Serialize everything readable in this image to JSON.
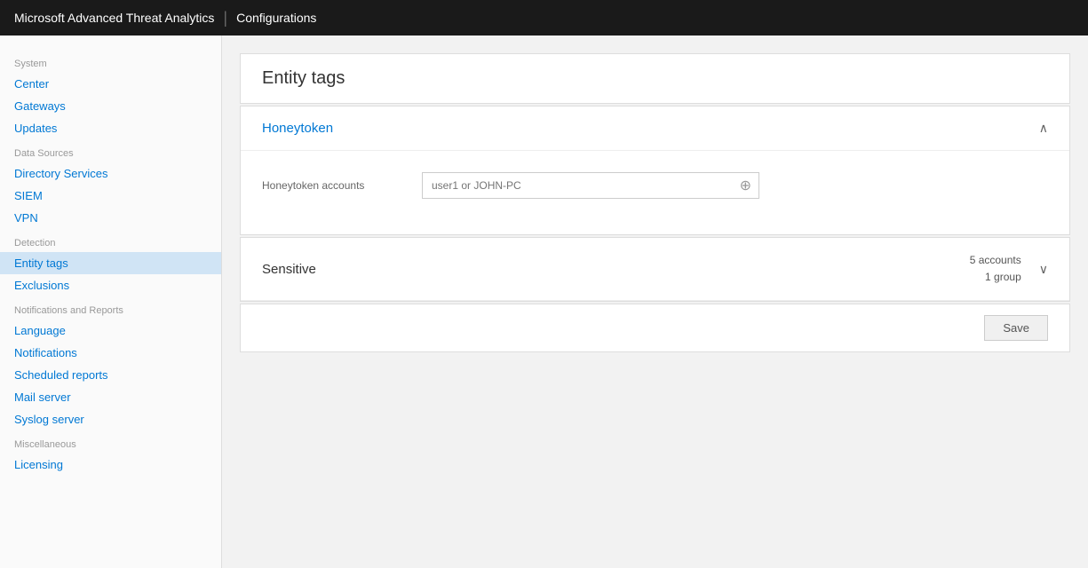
{
  "header": {
    "app_name": "Microsoft Advanced Threat Analytics",
    "divider": "|",
    "section": "Configurations"
  },
  "sidebar": {
    "system_label": "System",
    "items_system": [
      {
        "id": "center",
        "label": "Center"
      },
      {
        "id": "gateways",
        "label": "Gateways"
      },
      {
        "id": "updates",
        "label": "Updates"
      }
    ],
    "data_sources_label": "Data Sources",
    "items_data_sources": [
      {
        "id": "directory-services",
        "label": "Directory Services"
      },
      {
        "id": "siem",
        "label": "SIEM"
      },
      {
        "id": "vpn",
        "label": "VPN"
      }
    ],
    "detection_label": "Detection",
    "items_detection": [
      {
        "id": "entity-tags",
        "label": "Entity tags",
        "active": true
      },
      {
        "id": "exclusions",
        "label": "Exclusions"
      }
    ],
    "notifications_reports_label": "Notifications and Reports",
    "items_notifications": [
      {
        "id": "language",
        "label": "Language"
      },
      {
        "id": "notifications",
        "label": "Notifications"
      },
      {
        "id": "scheduled-reports",
        "label": "Scheduled reports"
      },
      {
        "id": "mail-server",
        "label": "Mail server"
      },
      {
        "id": "syslog-server",
        "label": "Syslog server"
      }
    ],
    "miscellaneous_label": "Miscellaneous",
    "items_misc": [
      {
        "id": "licensing",
        "label": "Licensing"
      }
    ]
  },
  "main": {
    "page_title": "Entity tags",
    "honeytoken": {
      "title": "Honeytoken",
      "accounts_label": "Honeytoken accounts",
      "accounts_placeholder": "user1 or JOHN-PC",
      "add_icon": "⊕"
    },
    "sensitive": {
      "title": "Sensitive",
      "accounts_count": "5 accounts",
      "group_count": "1 group",
      "chevron": "∨"
    },
    "save_button": "Save"
  },
  "icons": {
    "chevron_up": "∧",
    "chevron_down": "∨",
    "add_circle": "⊕"
  }
}
